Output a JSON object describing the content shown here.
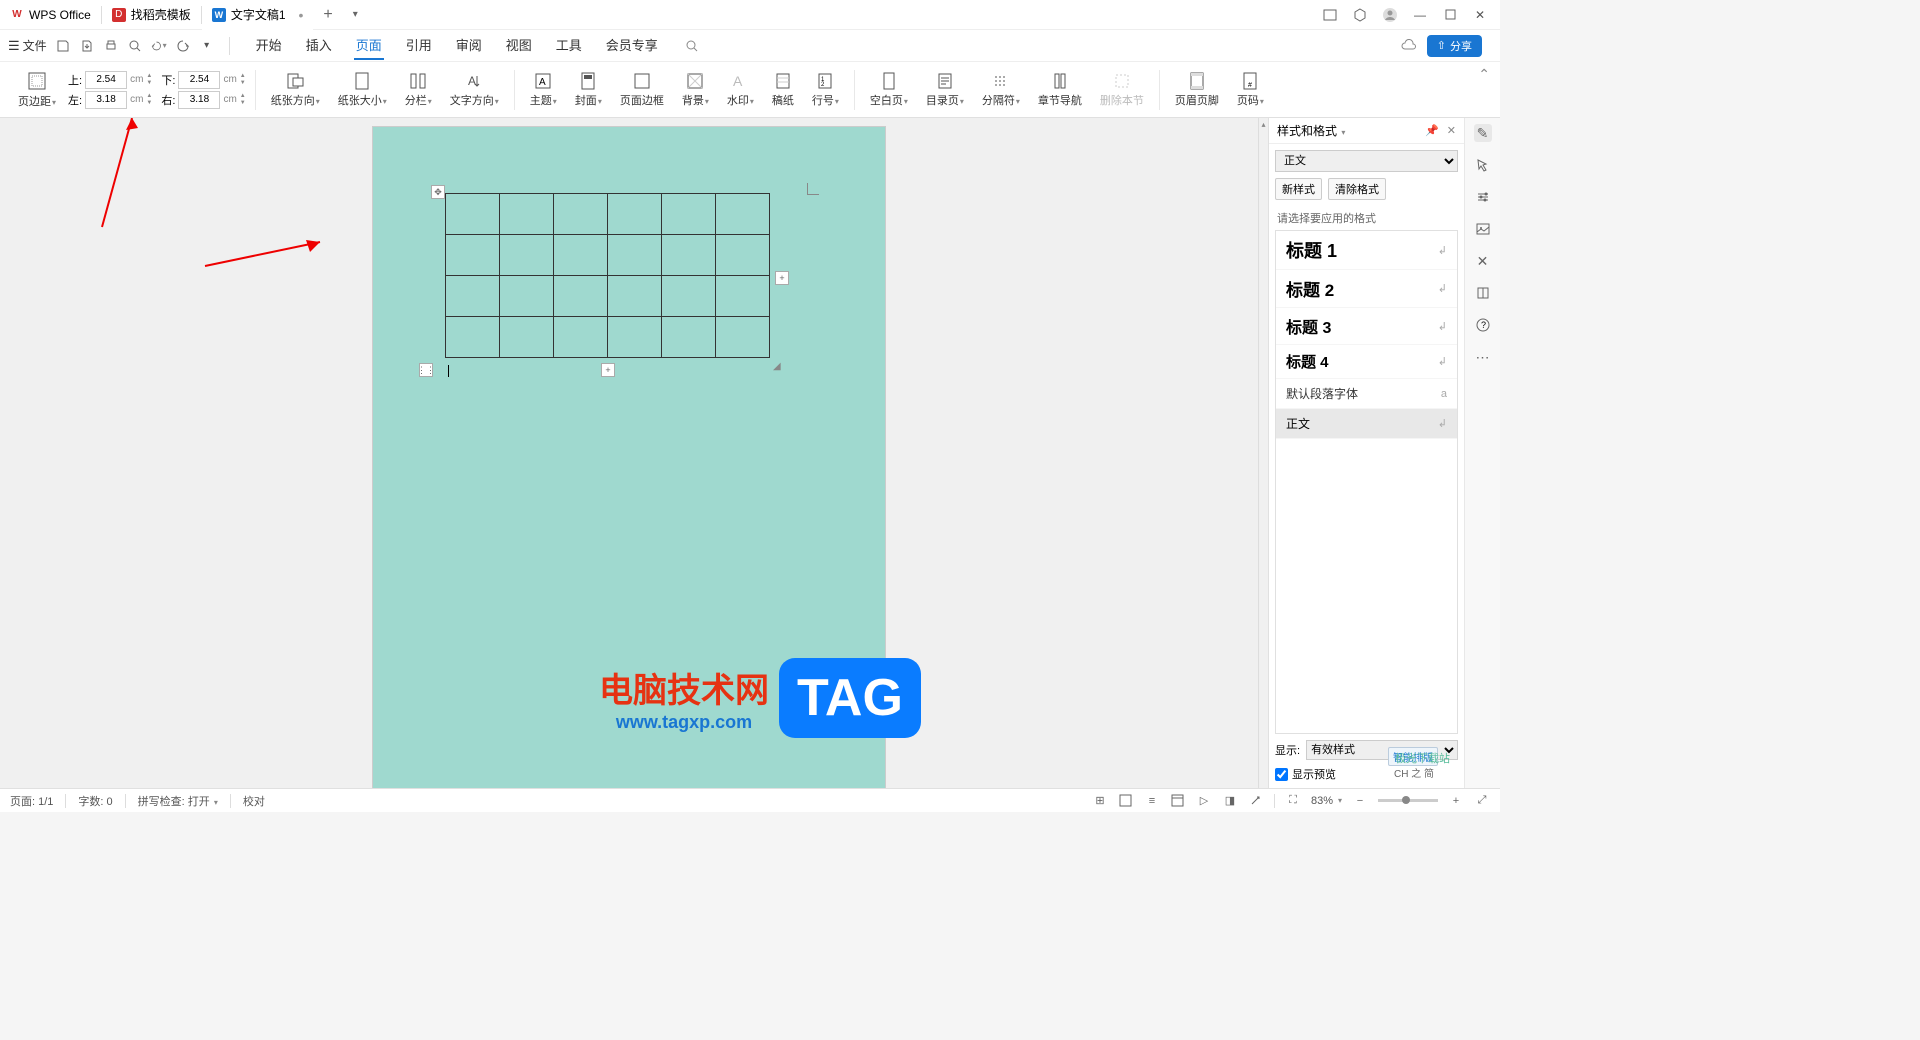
{
  "tabs": {
    "wps": "WPS Office",
    "template": "找稻壳模板",
    "doc": "文字文稿1"
  },
  "file_menu": "文件",
  "menus": {
    "start": "开始",
    "insert": "插入",
    "page": "页面",
    "ref": "引用",
    "review": "审阅",
    "view": "视图",
    "tools": "工具",
    "member": "会员专享"
  },
  "share": "分享",
  "ribbon": {
    "margin_label": "页边距",
    "top": "上:",
    "top_val": "2.54",
    "bottom": "下:",
    "bottom_val": "2.54",
    "left": "左:",
    "left_val": "3.18",
    "right": "右:",
    "right_val": "3.18",
    "unit": "cm",
    "orientation": "纸张方向",
    "size": "纸张大小",
    "columns": "分栏",
    "text_dir": "文字方向",
    "theme": "主题",
    "cover": "封面",
    "page_border": "页面边框",
    "background": "背景",
    "watermark": "水印",
    "paper_art": "稿纸",
    "line_num": "行号",
    "blank_page": "空白页",
    "toc_page": "目录页",
    "separator": "分隔符",
    "chapter_nav": "章节导航",
    "delete_section": "删除本节",
    "header_footer": "页眉页脚",
    "page_num": "页码"
  },
  "panel": {
    "title": "样式和格式",
    "current": "正文",
    "new_style": "新样式",
    "clear": "清除格式",
    "prompt": "请选择要应用的格式",
    "h1": "标题 1",
    "h2": "标题 2",
    "h3": "标题 3",
    "h4": "标题 4",
    "default_font": "默认段落字体",
    "normal": "正文",
    "show": "显示:",
    "show_val": "有效样式",
    "preview": "显示预览",
    "smart": "智能排版"
  },
  "status": {
    "page": "页面: 1/1",
    "words": "字数: 0",
    "spell": "拼写检查: 打开",
    "proof": "校对",
    "zoom": "83%",
    "ime": "CH 之 简"
  },
  "watermark": {
    "cn": "电脑技术网",
    "url": "www.tagxp.com",
    "tag": "TAG",
    "site": "极光下载站"
  }
}
